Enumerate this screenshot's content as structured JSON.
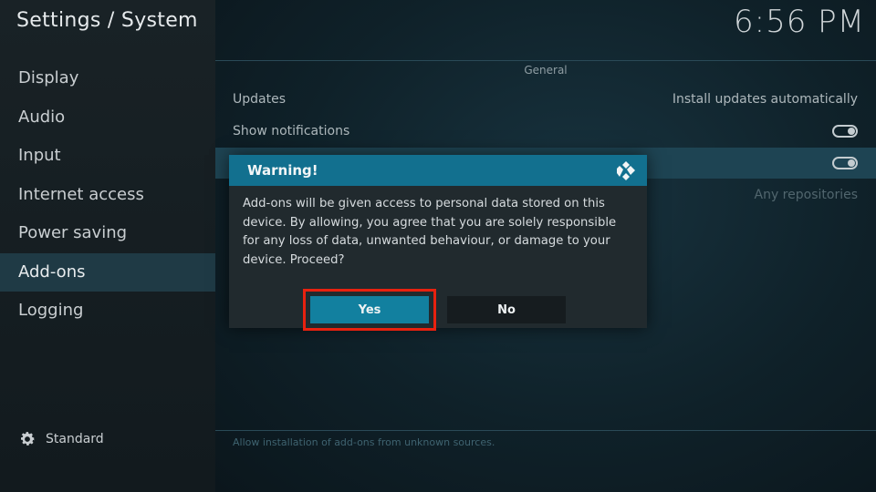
{
  "header": {
    "title": "Settings / System",
    "clock": "6:56 PM"
  },
  "sidebar": {
    "items": [
      {
        "label": "Display"
      },
      {
        "label": "Audio"
      },
      {
        "label": "Input"
      },
      {
        "label": "Internet access"
      },
      {
        "label": "Power saving"
      },
      {
        "label": "Add-ons",
        "active": true
      },
      {
        "label": "Logging"
      }
    ],
    "level_label": "Standard"
  },
  "main": {
    "section": "General",
    "rows": [
      {
        "label": "Updates",
        "value": "Install updates automatically"
      },
      {
        "label": "Show notifications",
        "toggle": "on"
      },
      {
        "label": "",
        "toggle": "on"
      },
      {
        "label": "",
        "value": "Any repositories"
      }
    ],
    "hint": "Allow installation of add-ons from unknown sources."
  },
  "dialog": {
    "title": "Warning!",
    "message": "Add-ons will be given access to personal data stored on this device. By allowing, you agree that you are solely responsible for any loss of data, unwanted behaviour, or damage to your device. Proceed?",
    "yes_label": "Yes",
    "no_label": "No"
  },
  "colors": {
    "accent": "#12708f",
    "highlight": "#e8210f"
  },
  "icons": {
    "level": "gear-icon",
    "dialog_logo": "kodi-logo-icon"
  }
}
